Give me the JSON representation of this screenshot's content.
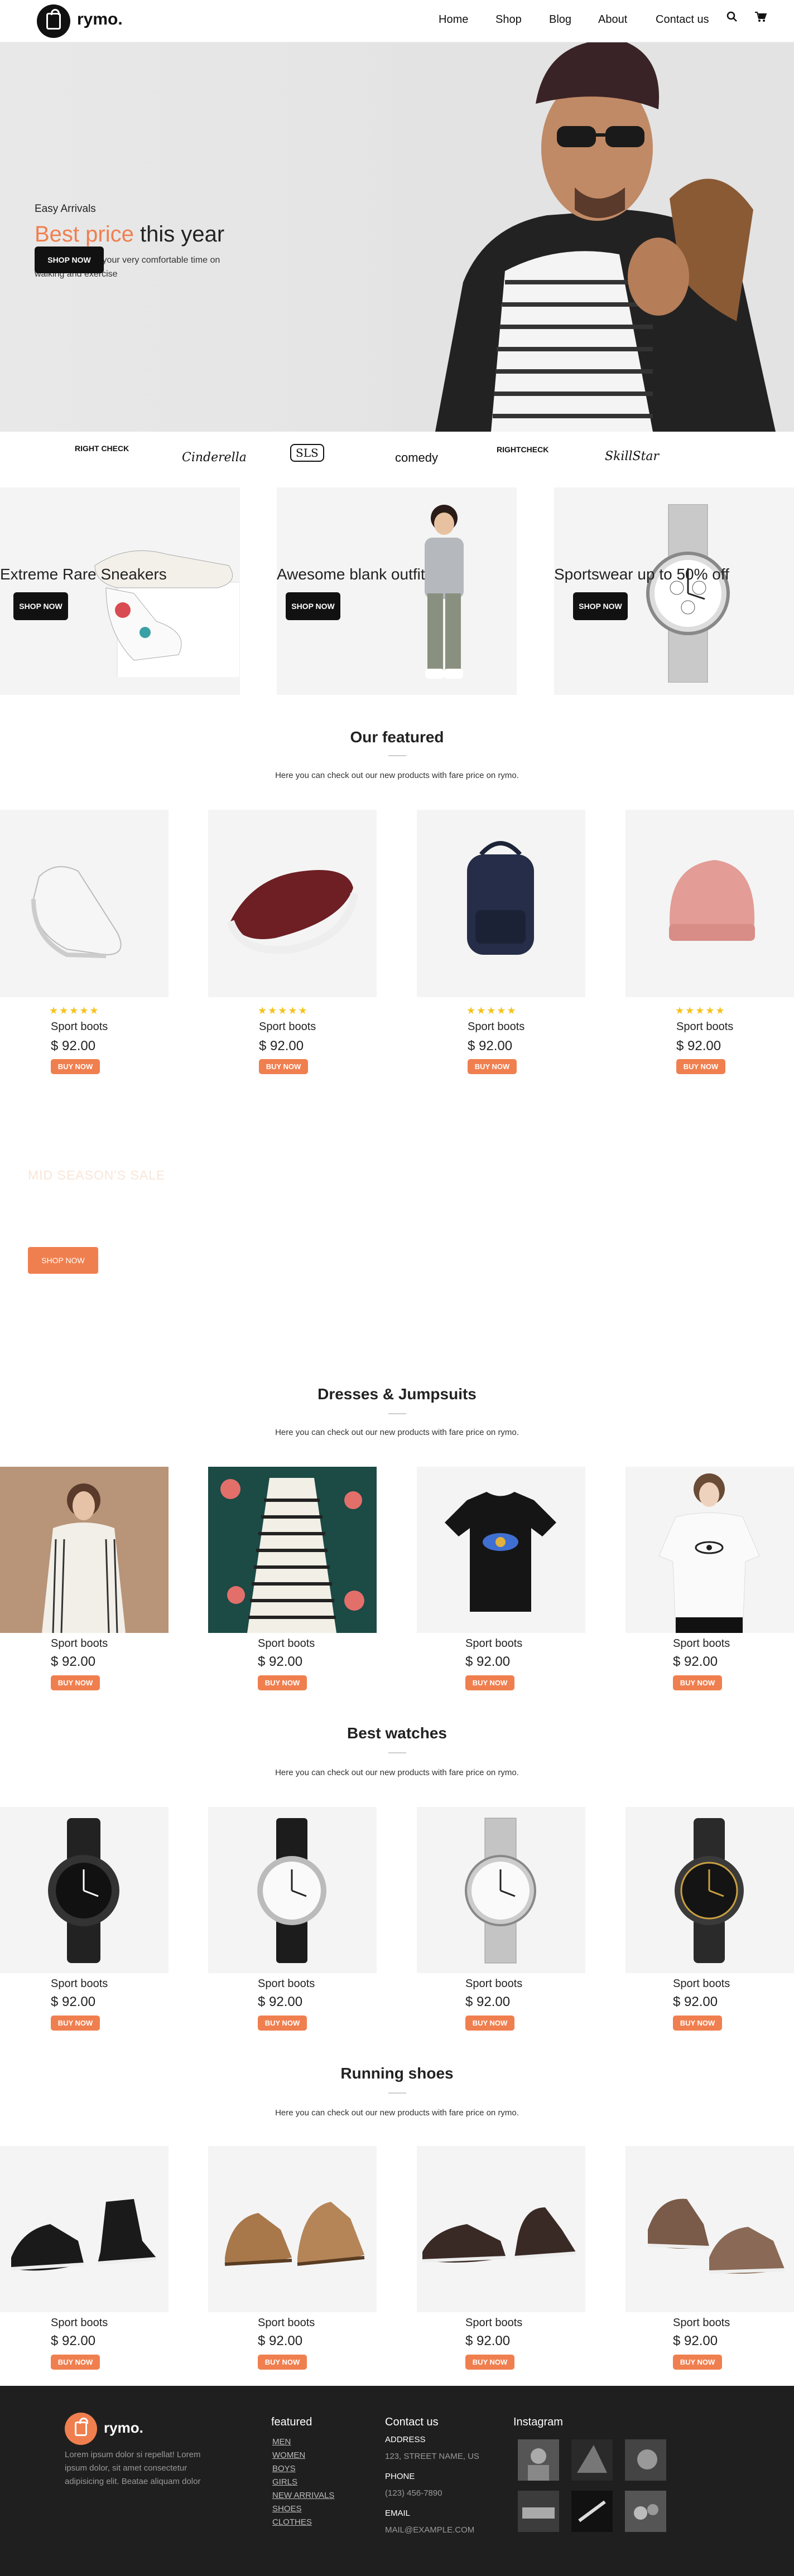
{
  "header": {
    "logo": "rymo.",
    "nav": [
      "Home",
      "Shop",
      "Blog",
      "About",
      "Contact us"
    ]
  },
  "hero": {
    "label": "Easy Arrivals",
    "title_accent": "Best price",
    "title_rest": " this year",
    "subtitle": "shoomatic offers your very comfortable time on walking and exercise",
    "button": "SHOP NOW"
  },
  "brands": [
    "RIGHT CHECK",
    "Cinderella",
    "SLS",
    "comedy",
    "RIGHTCHECK",
    "SkillStar"
  ],
  "promos": [
    {
      "title": "Extreme Rare Sneakers",
      "button": "SHOP NOW"
    },
    {
      "title": "Awesome blank outfit",
      "button": "SHOP NOW"
    },
    {
      "title": "Sportswear up to 50% off",
      "button": "SHOP NOW"
    }
  ],
  "featured": {
    "title": "Our featured",
    "subtitle": "Here you can check out our new products with fare price on rymo.",
    "products": [
      {
        "name": "Sport boots",
        "price": "$ 92.00",
        "button": "BUY NOW",
        "stars": "★★★★★"
      },
      {
        "name": "Sport boots",
        "price": "$ 92.00",
        "button": "BUY NOW",
        "stars": "★★★★★"
      },
      {
        "name": "Sport boots",
        "price": "$ 92.00",
        "button": "BUY NOW",
        "stars": "★★★★★"
      },
      {
        "name": "Sport boots",
        "price": "$ 92.00",
        "button": "BUY NOW",
        "stars": "★★★★★"
      }
    ]
  },
  "sale": {
    "title": "MID SEASON'S SALE",
    "button": "SHOP NOW"
  },
  "dresses": {
    "title": "Dresses & Jumpsuits",
    "subtitle": "Here you can check out our new products with fare price on rymo.",
    "products": [
      {
        "name": "Sport boots",
        "price": "$ 92.00",
        "button": "BUY NOW"
      },
      {
        "name": "Sport boots",
        "price": "$ 92.00",
        "button": "BUY NOW"
      },
      {
        "name": "Sport boots",
        "price": "$ 92.00",
        "button": "BUY NOW"
      },
      {
        "name": "Sport boots",
        "price": "$ 92.00",
        "button": "BUY NOW"
      }
    ]
  },
  "watches": {
    "title": "Best watches",
    "subtitle": "Here you can check out our new products with fare price on rymo.",
    "products": [
      {
        "name": "Sport boots",
        "price": "$ 92.00",
        "button": "BUY NOW"
      },
      {
        "name": "Sport boots",
        "price": "$ 92.00",
        "button": "BUY NOW"
      },
      {
        "name": "Sport boots",
        "price": "$ 92.00",
        "button": "BUY NOW"
      },
      {
        "name": "Sport boots",
        "price": "$ 92.00",
        "button": "BUY NOW"
      }
    ]
  },
  "shoes": {
    "title": "Running shoes",
    "subtitle": "Here you can check out our new products with fare price on rymo.",
    "products": [
      {
        "name": "Sport boots",
        "price": "$ 92.00",
        "button": "BUY NOW"
      },
      {
        "name": "Sport boots",
        "price": "$ 92.00",
        "button": "BUY NOW"
      },
      {
        "name": "Sport boots",
        "price": "$ 92.00",
        "button": "BUY NOW"
      },
      {
        "name": "Sport boots",
        "price": "$ 92.00",
        "button": "BUY NOW"
      }
    ]
  },
  "footer": {
    "logo": "rymo.",
    "about": "Lorem ipsum dolor si repellat! Lorem ipsum dolor, sit amet consectetur adipisicing elit. Beatae aliquam dolor",
    "featured_title": "featured",
    "featured_links": [
      "MEN",
      "WOMEN",
      "BOYS",
      "GIRLS",
      "NEW ARRIVALS",
      "SHOES",
      "CLOTHES"
    ],
    "contact_title": "Contact us",
    "address_label": "ADDRESS",
    "address": "123, STREET NAME, US",
    "phone_label": "PHONE",
    "phone": "(123) 456-7890",
    "email_label": "EMAIL",
    "email": "MAIL@EXAMPLE.COM",
    "instagram_title": "Instagram"
  },
  "colors": {
    "accent": "#f07f4f",
    "dark": "#111111",
    "footer": "#1f1f1f",
    "star": "#f6c21c"
  }
}
